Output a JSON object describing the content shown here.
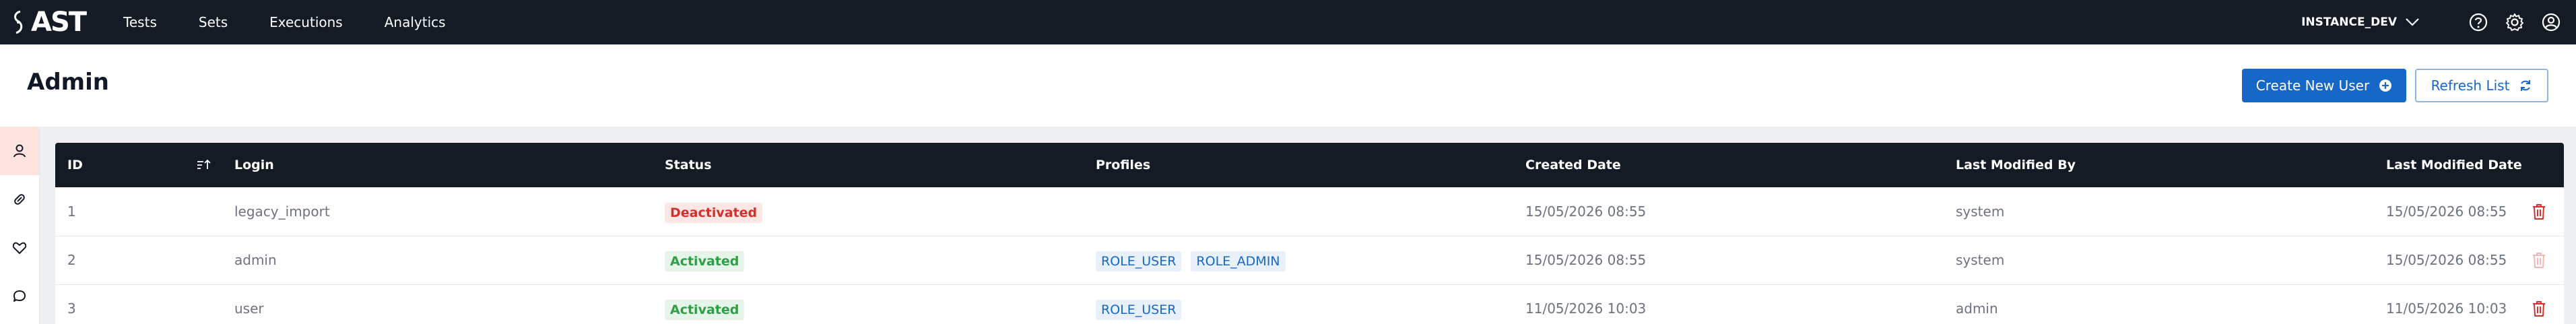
{
  "app": {
    "brand": "AST",
    "nav": [
      "Tests",
      "Sets",
      "Executions",
      "Analytics"
    ],
    "instance": "INSTANCE_DEV",
    "icons": [
      "brand-logo-icon",
      "chevron-down-icon",
      "help-icon",
      "gear-icon",
      "user-circle-icon"
    ]
  },
  "page": {
    "title": "Admin",
    "create_button": "Create New User",
    "refresh_button": "Refresh List"
  },
  "sidebar": {
    "items": [
      {
        "icon": "user-icon",
        "active": true
      },
      {
        "icon": "pill-icon",
        "active": false
      },
      {
        "icon": "heart-icon",
        "active": false
      },
      {
        "icon": "chat-icon",
        "active": false
      }
    ]
  },
  "table": {
    "columns": [
      "ID",
      "Login",
      "Status",
      "Profiles",
      "Created Date",
      "Last Modified By",
      "Last Modified Date"
    ],
    "rows": [
      {
        "id": "1",
        "login": "legacy_import",
        "status": "Deactivated",
        "profiles": [],
        "created": "15/05/2026 08:55",
        "modified_by": "system",
        "modified": "15/05/2026 08:55",
        "delete_enabled": true
      },
      {
        "id": "2",
        "login": "admin",
        "status": "Activated",
        "profiles": [
          "ROLE_USER",
          "ROLE_ADMIN"
        ],
        "created": "15/05/2026 08:55",
        "modified_by": "system",
        "modified": "15/05/2026 08:55",
        "delete_enabled": false
      },
      {
        "id": "3",
        "login": "user",
        "status": "Activated",
        "profiles": [
          "ROLE_USER"
        ],
        "created": "11/05/2026 10:03",
        "modified_by": "admin",
        "modified": "11/05/2026 10:03",
        "delete_enabled": true
      }
    ]
  },
  "colors": {
    "nav_bg": "#141b24",
    "primary": "#1767c9",
    "danger": "#d0312d",
    "success": "#2f9e44"
  }
}
